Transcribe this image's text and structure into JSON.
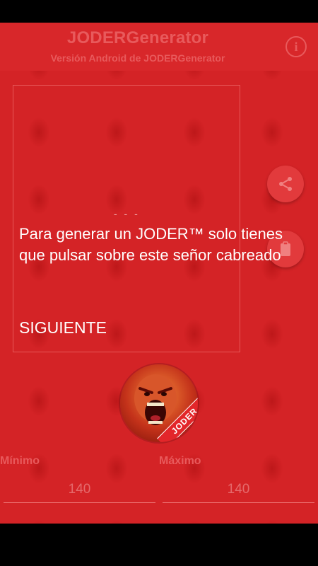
{
  "header": {
    "title": "JODERGenerator",
    "subtitle": "Versión Android de JODERGenerator",
    "info_icon": "info-icon"
  },
  "tutorial": {
    "page_indicator": "- - -",
    "message": "Para generar un JODER™ solo tienes que pulsar sobre este señor cabreado",
    "next_label": "SIGUIENTE"
  },
  "fabs": {
    "share_icon": "share-icon",
    "clipboard_icon": "clipboard-icon"
  },
  "generator": {
    "badge_text": "JODER",
    "min_label": "Mínimo",
    "max_label": "Máximo",
    "min_value": "140",
    "max_value": "140"
  },
  "colors": {
    "background": "#d42326",
    "accent": "#e85a5c"
  }
}
